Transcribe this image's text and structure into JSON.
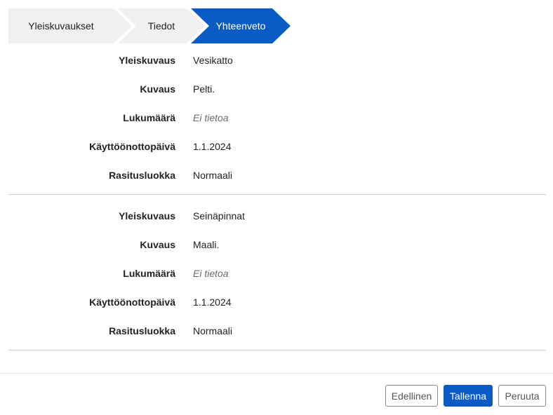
{
  "stepper": {
    "steps": [
      {
        "label": "Yleiskuvaukset",
        "active": false
      },
      {
        "label": "Tiedot",
        "active": false
      },
      {
        "label": "Yhteenveto",
        "active": true
      }
    ],
    "active_color": "#0a5cc4",
    "inactive_color": "#f0f0f0"
  },
  "groups": [
    {
      "rows": [
        {
          "label": "Yleiskuvaus",
          "value": "Vesikatto"
        },
        {
          "label": "Kuvaus",
          "value": "Pelti."
        },
        {
          "label": "Lukumäärä",
          "value": "Ei tietoa"
        },
        {
          "label": "Käyttöönottopäivä",
          "value": "1.1.2024"
        },
        {
          "label": "Rasitusluokka",
          "value": "Normaali"
        }
      ]
    },
    {
      "rows": [
        {
          "label": "Yleiskuvaus",
          "value": "Seinäpinnat"
        },
        {
          "label": "Kuvaus",
          "value": "Maali."
        },
        {
          "label": "Lukumäärä",
          "value": "Ei tietoa"
        },
        {
          "label": "Käyttöönottopäivä",
          "value": "1.1.2024"
        },
        {
          "label": "Rasitusluokka",
          "value": "Normaali"
        }
      ]
    }
  ],
  "footer": {
    "previous_label": "Edellinen",
    "save_label": "Tallenna",
    "cancel_label": "Peruuta",
    "primary_color": "#0a5cc4"
  }
}
